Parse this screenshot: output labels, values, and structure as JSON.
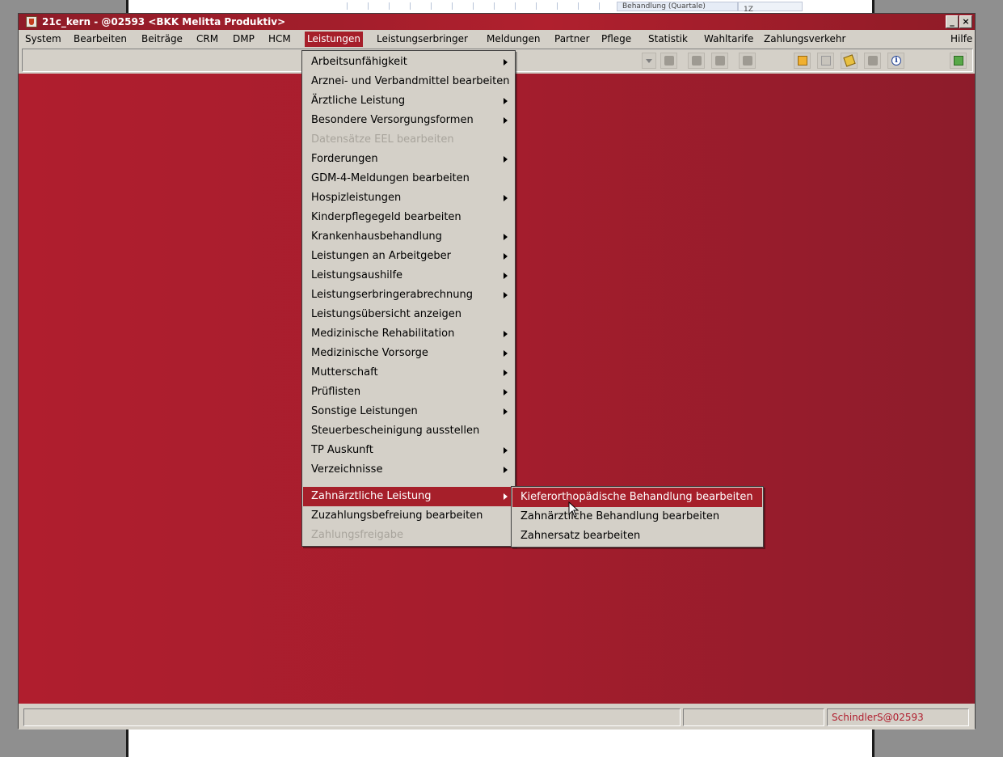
{
  "background": {
    "strip_label": "Behandlung (Quartale)",
    "strip_value": "1Z"
  },
  "window": {
    "title": "21c_kern - @02593 <BKK Melitta Produktiv>",
    "minimize_glyph": "_",
    "close_glyph": "×"
  },
  "menubar": {
    "items": [
      "System",
      "Bearbeiten",
      "Beiträge",
      "CRM",
      "DMP",
      "HCM",
      "Leistungen",
      "Leistungserbringer",
      "Meldungen",
      "Partner",
      "Pflege",
      "Statistik",
      "Wahltarife",
      "Zahlungsverkehr"
    ],
    "active": "Leistungen",
    "help": "Hilfe"
  },
  "toolbar": {
    "icons": [
      "dropdown-icon",
      "calculator-icon",
      "back-icon",
      "back-all-icon",
      "forward-icon",
      "clipboard-icon",
      "notes-icon",
      "tag-icon",
      "print-icon",
      "info-icon",
      "exit-icon"
    ],
    "info_glyph": "i"
  },
  "leistungen_menu": {
    "items": [
      {
        "label": "Arbeitsunfähigkeit",
        "submenu": true,
        "enabled": true
      },
      {
        "label": "Arznei- und Verbandmittel bearbeiten",
        "submenu": false,
        "enabled": true
      },
      {
        "label": "Ärztliche Leistung",
        "submenu": true,
        "enabled": true
      },
      {
        "label": "Besondere Versorgungsformen",
        "submenu": true,
        "enabled": true
      },
      {
        "label": "Datensätze EEL bearbeiten",
        "submenu": false,
        "enabled": false
      },
      {
        "label": "Forderungen",
        "submenu": true,
        "enabled": true
      },
      {
        "label": "GDM-4-Meldungen bearbeiten",
        "submenu": false,
        "enabled": true
      },
      {
        "label": "Hospizleistungen",
        "submenu": true,
        "enabled": true
      },
      {
        "label": "Kinderpflegegeld bearbeiten",
        "submenu": false,
        "enabled": true
      },
      {
        "label": "Krankenhausbehandlung",
        "submenu": true,
        "enabled": true
      },
      {
        "label": "Leistungen an Arbeitgeber",
        "submenu": true,
        "enabled": true
      },
      {
        "label": "Leistungsaushilfe",
        "submenu": true,
        "enabled": true
      },
      {
        "label": "Leistungserbringerabrechnung",
        "submenu": true,
        "enabled": true
      },
      {
        "label": "Leistungsübersicht anzeigen",
        "submenu": false,
        "enabled": true
      },
      {
        "label": "Medizinische Rehabilitation",
        "submenu": true,
        "enabled": true
      },
      {
        "label": "Medizinische Vorsorge",
        "submenu": true,
        "enabled": true
      },
      {
        "label": "Mutterschaft",
        "submenu": true,
        "enabled": true
      },
      {
        "label": "Prüflisten",
        "submenu": true,
        "enabled": true
      },
      {
        "label": "Sonstige Leistungen",
        "submenu": true,
        "enabled": true
      },
      {
        "label": "Steuerbescheinigung ausstellen",
        "submenu": false,
        "enabled": true
      },
      {
        "label": "TP Auskunft",
        "submenu": true,
        "enabled": true
      },
      {
        "label": "Verzeichnisse",
        "submenu": true,
        "enabled": true
      },
      {
        "label": "Zahnärztliche Leistung",
        "submenu": true,
        "enabled": true,
        "highlighted": true
      },
      {
        "label": "Zuzahlungsbefreiung bearbeiten",
        "submenu": false,
        "enabled": true
      },
      {
        "label": "Zahlungsfreigabe",
        "submenu": false,
        "enabled": false
      }
    ]
  },
  "zahnaerztliche_submenu": {
    "items": [
      {
        "label": "Kieferorthopädische Behandlung bearbeiten",
        "highlighted": true
      },
      {
        "label": "Zahnärztliche Behandlung bearbeiten",
        "highlighted": false
      },
      {
        "label": "Zahnersatz bearbeiten",
        "highlighted": false
      }
    ]
  },
  "statusbar": {
    "user": "SchindlerS@02593",
    "fields": [
      "",
      ""
    ]
  },
  "colors": {
    "accent": "#a61f2a",
    "desktop": "#b01e2e",
    "chrome": "#d4d0c8"
  }
}
